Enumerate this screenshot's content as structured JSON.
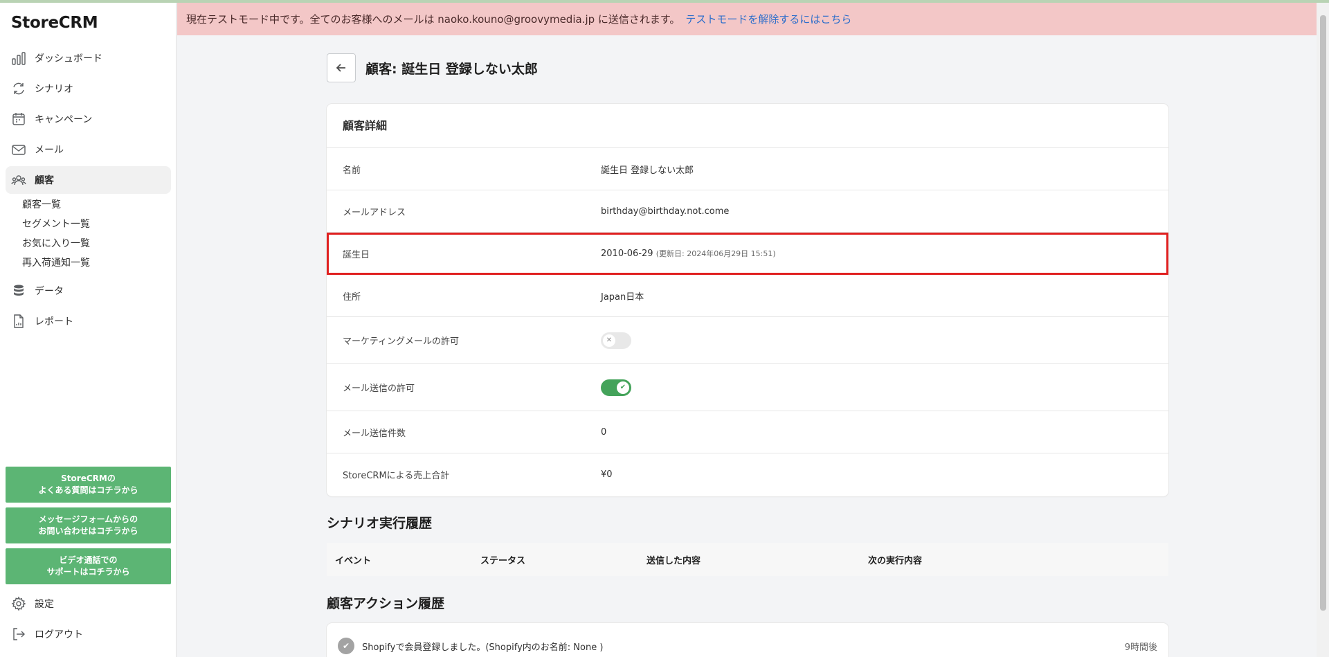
{
  "app": {
    "logo": "StoreCRM"
  },
  "sidebar": {
    "items": [
      {
        "label": "ダッシュボード",
        "icon": "bar-chart-icon"
      },
      {
        "label": "シナリオ",
        "icon": "refresh-icon"
      },
      {
        "label": "キャンペーン",
        "icon": "calendar-icon"
      },
      {
        "label": "メール",
        "icon": "mail-icon"
      },
      {
        "label": "顧客",
        "icon": "people-icon",
        "active": true
      },
      {
        "label": "データ",
        "icon": "database-icon"
      },
      {
        "label": "レポート",
        "icon": "report-icon"
      }
    ],
    "subitems": [
      "顧客一覧",
      "セグメント一覧",
      "お気に入り一覧",
      "再入荷通知一覧"
    ],
    "support_buttons": [
      "StoreCRMの\nよくある質問はコチラから",
      "メッセージフォームからの\nお問い合わせはコチラから",
      "ビデオ通話での\nサポートはコチラから"
    ],
    "bottom": [
      {
        "label": "設定",
        "icon": "gear-icon"
      },
      {
        "label": "ログアウト",
        "icon": "logout-icon"
      }
    ]
  },
  "banner": {
    "text": "現在テストモード中です。全てのお客様へのメールは naoko.kouno@groovymedia.jp に送信されます。",
    "link": "テストモードを解除するにはこちら"
  },
  "page": {
    "title": "顧客: 誕生日 登録しない太郎"
  },
  "details": {
    "title": "顧客詳細",
    "rows": [
      {
        "label": "名前",
        "value": "誕生日 登録しない太郎"
      },
      {
        "label": "メールアドレス",
        "value": "birthday@birthday.not.come"
      },
      {
        "label": "誕生日",
        "value": "2010-06-29",
        "note": "(更新日: 2024年06月29日 15:51)"
      },
      {
        "label": "住所",
        "value": "Japan日本"
      },
      {
        "label": "マーケティングメールの許可",
        "toggle": "off"
      },
      {
        "label": "メール送信の許可",
        "toggle": "on"
      },
      {
        "label": "メール送信件数",
        "value": "0"
      },
      {
        "label": "StoreCRMによる売上合計",
        "value": "¥0"
      }
    ]
  },
  "scenario_history": {
    "title": "シナリオ実行履歴",
    "columns": [
      "イベント",
      "ステータス",
      "送信した内容",
      "次の実行内容"
    ]
  },
  "action_history": {
    "title": "顧客アクション履歴",
    "items": [
      {
        "text": "Shopifyで会員登録しました。(Shopify内のお名前: None )",
        "time": "9時間後"
      }
    ]
  }
}
